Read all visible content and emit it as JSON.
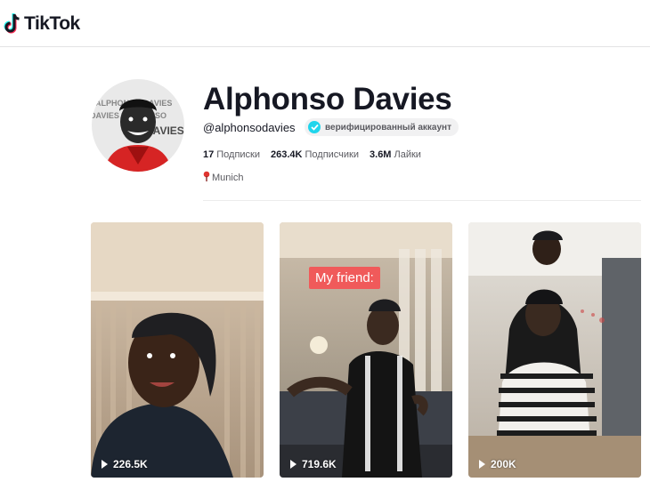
{
  "header": {
    "brand": "TikTok"
  },
  "profile": {
    "name": "Alphonso Davies",
    "handle": "@alphonsodavies",
    "verified_label": "верифицированный аккаунт",
    "location": "Munich",
    "stats": [
      {
        "value": "17",
        "label": "Подписки"
      },
      {
        "value": "263.4K",
        "label": "Подписчики"
      },
      {
        "value": "3.6M",
        "label": "Лайки"
      }
    ]
  },
  "videos": [
    {
      "views": "226.5K",
      "caption": ""
    },
    {
      "views": "719.6K",
      "caption": "My friend:"
    },
    {
      "views": "200K",
      "caption": ""
    }
  ],
  "colors": {
    "accent": "#20d5ec",
    "caption_bg": "#f05a5a",
    "text": "#161823",
    "muted": "#59595f"
  },
  "icons": [
    "tiktok-logo-icon",
    "verified-check-icon",
    "location-pin-icon",
    "play-icon"
  ]
}
